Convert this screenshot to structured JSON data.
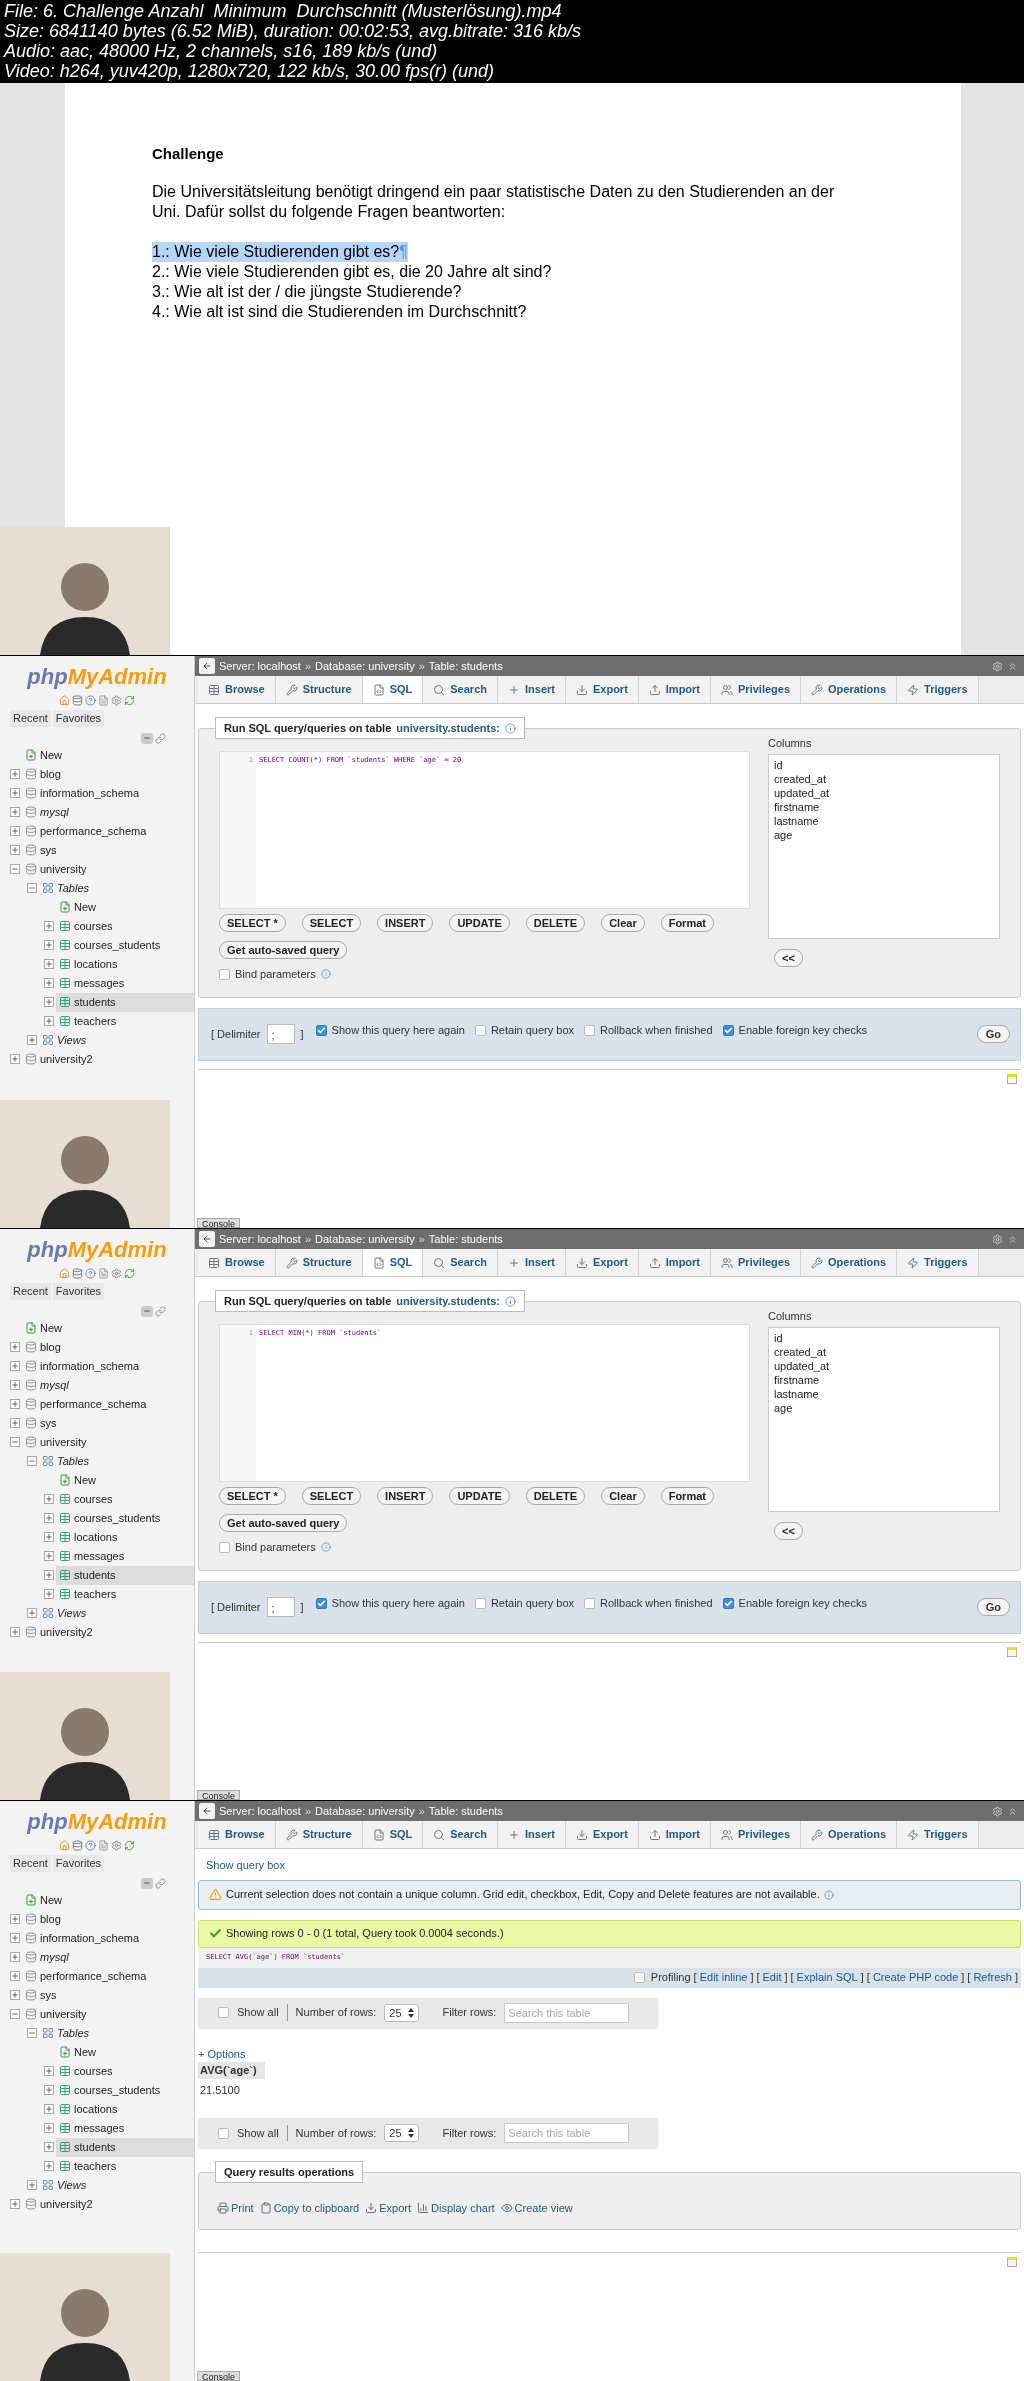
{
  "file_info": [
    "File: 6. Challenge Anzahl  Minimum  Durchschnitt (Musterlösung).mp4",
    "Size: 6841140 bytes (6.52 MiB), duration: 00:02:53, avg.bitrate: 316 kb/s",
    "Audio: aac, 48000 Hz, 2 channels, s16, 189 kb/s (und)",
    "Video: h264, yuv420p, 1280x720, 122 kb/s, 30.00 fps(r) (und)"
  ],
  "frames": [
    {
      "kind": "document",
      "title": "Challenge",
      "paragraph_lines": [
        "Die Universitätsleitung benötigt dringend ein paar statistische Daten zu den Studierenden an der",
        "Uni. Dafür sollst du folgende Fragen beantworten:"
      ],
      "end_mark": "¶",
      "questions": [
        {
          "text": "1.: Wie viele Studierenden gibt es?",
          "selected": true
        },
        {
          "text": "2.: Wie viele Studierenden gibt es, die 20 Jahre alt sind?",
          "selected": false
        },
        {
          "text": "3.: Wie alt ist der / die jüngste Studierende?",
          "selected": false
        },
        {
          "text": "4.: Wie alt ist sind die Studierenden im Durchschnitt?",
          "selected": false
        }
      ]
    },
    {
      "kind": "sql",
      "sidebar": {
        "logo": [
          "php",
          "MyAdmin"
        ],
        "nav_tabs": [
          "Recent",
          "Favorites"
        ],
        "tree": [
          {
            "label": "New",
            "kind": "new"
          },
          {
            "label": "blog",
            "kind": "database",
            "expanded": false
          },
          {
            "label": "information_schema",
            "kind": "database",
            "expanded": false
          },
          {
            "label": "mysql",
            "kind": "database",
            "expanded": false,
            "italic": true
          },
          {
            "label": "performance_schema",
            "kind": "database",
            "expanded": false
          },
          {
            "label": "sys",
            "kind": "database",
            "expanded": false
          },
          {
            "label": "university",
            "kind": "database",
            "expanded": true,
            "children": [
              {
                "label": "Tables",
                "kind": "group",
                "expanded": true,
                "italic": true,
                "children": [
                  {
                    "label": "New",
                    "kind": "new",
                    "selected": false
                  },
                  {
                    "label": "courses",
                    "kind": "table",
                    "expanded": false,
                    "selected": false
                  },
                  {
                    "label": "courses_students",
                    "kind": "table",
                    "expanded": false,
                    "selected": false
                  },
                  {
                    "label": "locations",
                    "kind": "table",
                    "expanded": false,
                    "selected": false
                  },
                  {
                    "label": "messages",
                    "kind": "table",
                    "expanded": false,
                    "selected": false
                  },
                  {
                    "label": "students",
                    "kind": "table",
                    "expanded": false,
                    "selected": true
                  },
                  {
                    "label": "teachers",
                    "kind": "table",
                    "expanded": false,
                    "selected": false
                  }
                ]
              },
              {
                "label": "Views",
                "kind": "group",
                "expanded": false,
                "italic": true
              }
            ]
          },
          {
            "label": "university2",
            "kind": "database",
            "expanded": false
          }
        ]
      },
      "breadcrumb": [
        "Server: localhost",
        "Database: university",
        "Table: students"
      ],
      "breadcrumb_separator": "»",
      "tabs": [
        {
          "label": "Browse",
          "selected": false
        },
        {
          "label": "Structure",
          "selected": false
        },
        {
          "label": "SQL",
          "selected": true
        },
        {
          "label": "Search",
          "selected": false
        },
        {
          "label": "Insert",
          "selected": false
        },
        {
          "label": "Export",
          "selected": false
        },
        {
          "label": "Import",
          "selected": false
        },
        {
          "label": "Privileges",
          "selected": false
        },
        {
          "label": "Operations",
          "selected": false
        },
        {
          "label": "Triggers",
          "selected": false
        }
      ],
      "query_panel": {
        "legend": "Run SQL query/queries on table",
        "legend_link": "university.students:",
        "line_number": "1",
        "query": "SELECT COUNT(*) FROM `students` WHERE `age` = 20",
        "columns_label": "Columns",
        "columns": [
          "id",
          "created_at",
          "updated_at",
          "firstname",
          "lastname",
          "age"
        ],
        "buttons": [
          "SELECT *",
          "SELECT",
          "INSERT",
          "UPDATE",
          "DELETE",
          "Clear",
          "Format"
        ],
        "autosave_button": "Get auto-saved query",
        "bind_parameters": {
          "label": "Bind parameters",
          "checked": false
        },
        "insert_button": "<<",
        "delimiter_label": "[ Delimiter",
        "delimiter_value": ";",
        "delimiter_close": "]",
        "options": [
          {
            "label": "Show this query here again",
            "checked": true
          },
          {
            "label": "Retain query box",
            "checked": false
          },
          {
            "label": "Rollback when finished",
            "checked": false
          },
          {
            "label": "Enable foreign key checks",
            "checked": true
          }
        ],
        "go_button": "Go"
      },
      "console": "Console"
    },
    {
      "kind": "sql",
      "sidebar": {
        "logo": [
          "php",
          "MyAdmin"
        ],
        "nav_tabs": [
          "Recent",
          "Favorites"
        ],
        "tree": [
          {
            "label": "New",
            "kind": "new"
          },
          {
            "label": "blog",
            "kind": "database",
            "expanded": false
          },
          {
            "label": "information_schema",
            "kind": "database",
            "expanded": false
          },
          {
            "label": "mysql",
            "kind": "database",
            "expanded": false,
            "italic": true
          },
          {
            "label": "performance_schema",
            "kind": "database",
            "expanded": false
          },
          {
            "label": "sys",
            "kind": "database",
            "expanded": false
          },
          {
            "label": "university",
            "kind": "database",
            "expanded": true,
            "children": [
              {
                "label": "Tables",
                "kind": "group",
                "expanded": true,
                "italic": true,
                "children": [
                  {
                    "label": "New",
                    "kind": "new",
                    "selected": false
                  },
                  {
                    "label": "courses",
                    "kind": "table",
                    "expanded": false,
                    "selected": false
                  },
                  {
                    "label": "courses_students",
                    "kind": "table",
                    "expanded": false,
                    "selected": false
                  },
                  {
                    "label": "locations",
                    "kind": "table",
                    "expanded": false,
                    "selected": false
                  },
                  {
                    "label": "messages",
                    "kind": "table",
                    "expanded": false,
                    "selected": false
                  },
                  {
                    "label": "students",
                    "kind": "table",
                    "expanded": false,
                    "selected": true
                  },
                  {
                    "label": "teachers",
                    "kind": "table",
                    "expanded": false,
                    "selected": false
                  }
                ]
              },
              {
                "label": "Views",
                "kind": "group",
                "expanded": false,
                "italic": true
              }
            ]
          },
          {
            "label": "university2",
            "kind": "database",
            "expanded": false
          }
        ]
      },
      "breadcrumb": [
        "Server: localhost",
        "Database: university",
        "Table: students"
      ],
      "breadcrumb_separator": "»",
      "tabs": [
        {
          "label": "Browse",
          "selected": false
        },
        {
          "label": "Structure",
          "selected": false
        },
        {
          "label": "SQL",
          "selected": true
        },
        {
          "label": "Search",
          "selected": false
        },
        {
          "label": "Insert",
          "selected": false
        },
        {
          "label": "Export",
          "selected": false
        },
        {
          "label": "Import",
          "selected": false
        },
        {
          "label": "Privileges",
          "selected": false
        },
        {
          "label": "Operations",
          "selected": false
        },
        {
          "label": "Triggers",
          "selected": false
        }
      ],
      "query_panel": {
        "legend": "Run SQL query/queries on table",
        "legend_link": "university.students:",
        "line_number": "1",
        "query": "SELECT MIN(*) FROM `students`",
        "columns_label": "Columns",
        "columns": [
          "id",
          "created_at",
          "updated_at",
          "firstname",
          "lastname",
          "age"
        ],
        "buttons": [
          "SELECT *",
          "SELECT",
          "INSERT",
          "UPDATE",
          "DELETE",
          "Clear",
          "Format"
        ],
        "autosave_button": "Get auto-saved query",
        "bind_parameters": {
          "label": "Bind parameters",
          "checked": false
        },
        "insert_button": "<<",
        "delimiter_label": "[ Delimiter",
        "delimiter_value": ";",
        "delimiter_close": "]",
        "options": [
          {
            "label": "Show this query here again",
            "checked": true
          },
          {
            "label": "Retain query box",
            "checked": false
          },
          {
            "label": "Rollback when finished",
            "checked": false
          },
          {
            "label": "Enable foreign key checks",
            "checked": true
          }
        ],
        "go_button": "Go"
      },
      "console": "Console"
    },
    {
      "kind": "result",
      "sidebar": {
        "logo": [
          "php",
          "MyAdmin"
        ],
        "nav_tabs": [
          "Recent",
          "Favorites"
        ],
        "tree": [
          {
            "label": "New",
            "kind": "new"
          },
          {
            "label": "blog",
            "kind": "database",
            "expanded": false
          },
          {
            "label": "information_schema",
            "kind": "database",
            "expanded": false
          },
          {
            "label": "mysql",
            "kind": "database",
            "expanded": false,
            "italic": true
          },
          {
            "label": "performance_schema",
            "kind": "database",
            "expanded": false
          },
          {
            "label": "sys",
            "kind": "database",
            "expanded": false
          },
          {
            "label": "university",
            "kind": "database",
            "expanded": true,
            "children": [
              {
                "label": "Tables",
                "kind": "group",
                "expanded": true,
                "italic": true,
                "children": [
                  {
                    "label": "New",
                    "kind": "new",
                    "selected": false
                  },
                  {
                    "label": "courses",
                    "kind": "table",
                    "expanded": false,
                    "selected": false
                  },
                  {
                    "label": "courses_students",
                    "kind": "table",
                    "expanded": false,
                    "selected": false
                  },
                  {
                    "label": "locations",
                    "kind": "table",
                    "expanded": false,
                    "selected": false
                  },
                  {
                    "label": "messages",
                    "kind": "table",
                    "expanded": false,
                    "selected": false
                  },
                  {
                    "label": "students",
                    "kind": "table",
                    "expanded": false,
                    "selected": true
                  },
                  {
                    "label": "teachers",
                    "kind": "table",
                    "expanded": false,
                    "selected": false
                  }
                ]
              },
              {
                "label": "Views",
                "kind": "group",
                "expanded": false,
                "italic": true
              }
            ]
          },
          {
            "label": "university2",
            "kind": "database",
            "expanded": false
          }
        ]
      },
      "breadcrumb": [
        "Server: localhost",
        "Database: university",
        "Table: students"
      ],
      "breadcrumb_separator": "»",
      "tabs": [
        {
          "label": "Browse",
          "selected": false
        },
        {
          "label": "Structure",
          "selected": false
        },
        {
          "label": "SQL",
          "selected": false
        },
        {
          "label": "Search",
          "selected": false
        },
        {
          "label": "Insert",
          "selected": false
        },
        {
          "label": "Export",
          "selected": false
        },
        {
          "label": "Import",
          "selected": false
        },
        {
          "label": "Privileges",
          "selected": false
        },
        {
          "label": "Operations",
          "selected": false
        },
        {
          "label": "Triggers",
          "selected": false
        }
      ],
      "show_query_box": "Show query box",
      "warning": "Current selection does not contain a unique column. Grid edit, checkbox, Edit, Copy and Delete features are not available.",
      "success": "Showing rows 0 - 0 (1 total, Query took 0.0004 seconds.)",
      "query": "SELECT AVG(`age`) FROM `students`",
      "profiling": {
        "label": "Profiling",
        "checked": false
      },
      "bracket_open": "[",
      "bracket_close": "]",
      "query_links": [
        "Edit inline",
        "Edit",
        "Explain SQL",
        "Create PHP code",
        "Refresh"
      ],
      "navigations": [
        {
          "show_all": {
            "label": "Show all",
            "checked": false
          },
          "rows_label": "Number of rows:",
          "rows_value": "25",
          "filter_label": "Filter rows:",
          "filter_placeholder": "Search this table"
        },
        {
          "show_all": {
            "label": "Show all",
            "checked": false
          },
          "rows_label": "Number of rows:",
          "rows_value": "25",
          "filter_label": "Filter rows:",
          "filter_placeholder": "Search this table"
        }
      ],
      "options_link": "+ Options",
      "result_column": "AVG(`age`)",
      "result_rows": [
        "21.5100"
      ],
      "operations": {
        "legend": "Query results operations",
        "items": [
          "Print",
          "Copy to clipboard",
          "Export",
          "Display chart",
          "Create view"
        ]
      },
      "console": "Console"
    }
  ]
}
